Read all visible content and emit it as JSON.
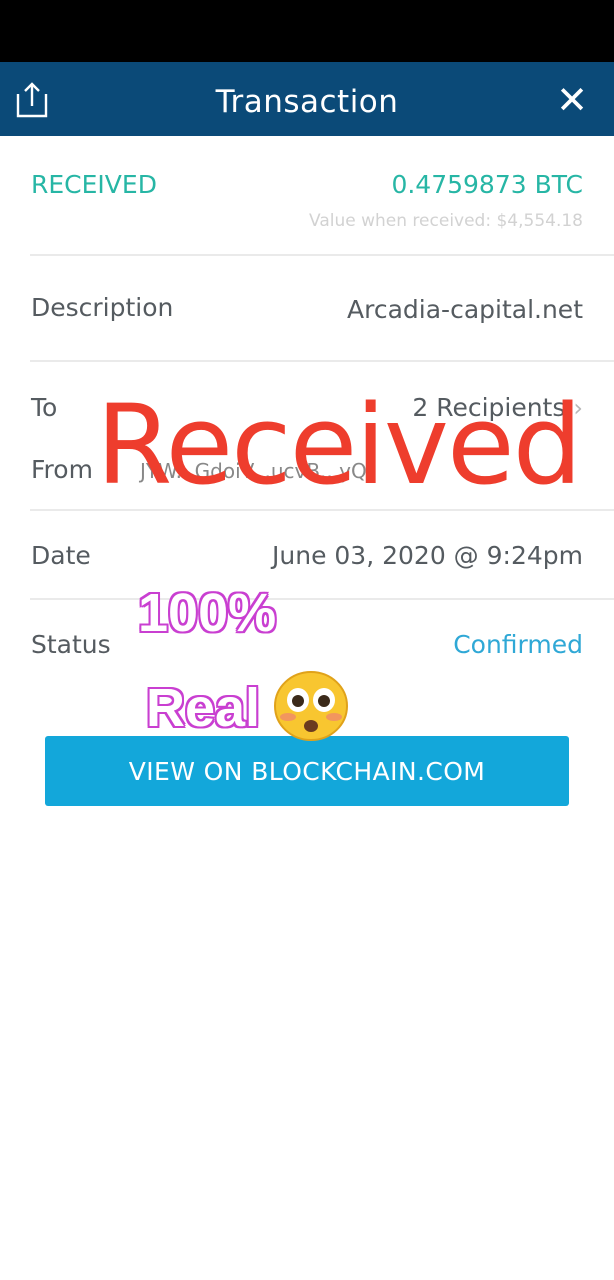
{
  "header": {
    "title": "Transaction",
    "share_icon": "share-icon",
    "close_icon": "close-icon",
    "close_glyph": "✕"
  },
  "summary": {
    "type_label": "RECEIVED",
    "amount": "0.4759873 BTC",
    "value_note": "Value when received: $4,554.18"
  },
  "details": {
    "description_label": "Description",
    "description_value": "Arcadia-capital.net",
    "to_label": "To",
    "to_value": "2 Recipients",
    "from_label": "From",
    "from_value": "JYW...GdoiV...ucvB...yQ",
    "date_label": "Date",
    "date_value": "June 03, 2020 @ 9:24pm",
    "status_label": "Status",
    "status_value": "Confirmed"
  },
  "actions": {
    "view_button": "VIEW ON BLOCKCHAIN.COM"
  },
  "overlay": {
    "stamp_text": "Received",
    "caption_line1": "100%",
    "caption_line2": "Real",
    "emoji": "flushed-face"
  },
  "colors": {
    "header_bg": "#0b4a78",
    "accent_teal": "#27b6a5",
    "status_blue": "#2fa8d6",
    "button_bg": "#13a7da",
    "stamp_red": "#ee3d2d",
    "caption_pink": "#c93fd1"
  }
}
